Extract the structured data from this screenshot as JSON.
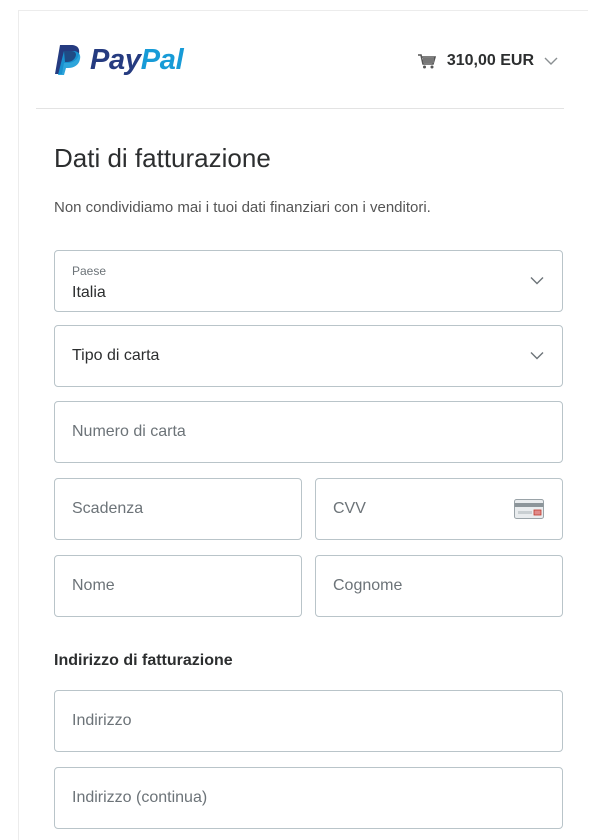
{
  "header": {
    "logo_pay": "Pay",
    "logo_pal": "Pal",
    "cart_total": "310,00 EUR"
  },
  "form": {
    "title": "Dati di fatturazione",
    "subtitle": "Non condividiamo mai i tuoi dati finanziari con i venditori.",
    "country": {
      "label": "Paese",
      "value": "Italia"
    },
    "card_type": {
      "value": "Tipo di carta"
    },
    "card_number": {
      "placeholder": "Numero di carta"
    },
    "expiry": {
      "placeholder": "Scadenza"
    },
    "cvv": {
      "placeholder": "CVV"
    },
    "first_name": {
      "placeholder": "Nome"
    },
    "last_name": {
      "placeholder": "Cognome"
    },
    "billing_section_title": "Indirizzo di fatturazione",
    "address": {
      "placeholder": "Indirizzo"
    },
    "address2": {
      "placeholder": "Indirizzo (continua)"
    }
  },
  "colors": {
    "brand_dark": "#253b80",
    "brand_light": "#179bd7",
    "border": "#b9c4c9",
    "text": "#2c2e2f",
    "placeholder": "#6c7378"
  },
  "icons": {
    "logo": "paypal-p-icon",
    "cart": "cart-icon",
    "dropdown": "chevron-down-icon",
    "cvv": "credit-card-icon"
  }
}
